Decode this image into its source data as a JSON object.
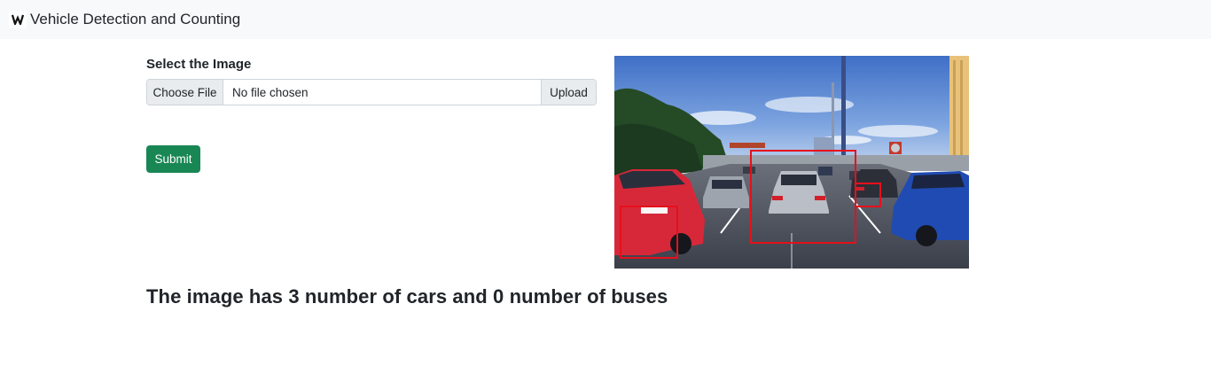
{
  "navbar": {
    "brand_title": "Vehicle Detection and Counting",
    "logo_icon": "w-logo-icon",
    "logo_letter": "W",
    "background": "#f8f9fa"
  },
  "form": {
    "label": "Select the Image",
    "choose_button": "Choose File",
    "file_status": "No file chosen",
    "upload_button": "Upload",
    "submit_button": "Submit",
    "submit_color": "#198754"
  },
  "result": {
    "image_description_icon": "detection-result-image",
    "box_color": "#e6101b",
    "text": "The image has 3 number of cars and 0 number of buses"
  }
}
